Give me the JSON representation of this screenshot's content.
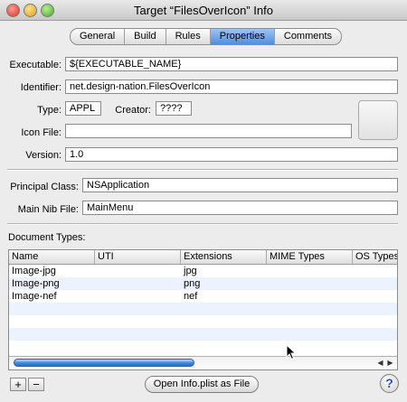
{
  "window": {
    "title": "Target “FilesOverIcon” Info"
  },
  "tabs": [
    {
      "label": "General",
      "active": false
    },
    {
      "label": "Build",
      "active": false
    },
    {
      "label": "Rules",
      "active": false
    },
    {
      "label": "Properties",
      "active": true
    },
    {
      "label": "Comments",
      "active": false
    }
  ],
  "form": {
    "executable_label": "Executable:",
    "executable_value": "${EXECUTABLE_NAME}",
    "identifier_label": "Identifier:",
    "identifier_value": "net.design-nation.FilesOverIcon",
    "type_label": "Type:",
    "type_value": "APPL",
    "creator_label": "Creator:",
    "creator_value": "????",
    "iconfile_label": "Icon File:",
    "iconfile_value": "",
    "version_label": "Version:",
    "version_value": "1.0",
    "principal_label": "Principal Class:",
    "principal_value": "NSApplication",
    "mainnib_label": "Main Nib File:",
    "mainnib_value": "MainMenu"
  },
  "doctypes": {
    "label": "Document Types:",
    "columns": [
      "Name",
      "UTI",
      "Extensions",
      "MIME Types",
      "OS Types"
    ],
    "rows": [
      {
        "name": "Image-jpg",
        "uti": "",
        "extensions": "jpg",
        "mime": "",
        "os": ""
      },
      {
        "name": "Image-png",
        "uti": "",
        "extensions": "png",
        "mime": "",
        "os": ""
      },
      {
        "name": "Image-nef",
        "uti": "",
        "extensions": "nef",
        "mime": "",
        "os": ""
      }
    ]
  },
  "footer": {
    "add_label": "+",
    "remove_label": "−",
    "open_plist_label": "Open Info.plist as File",
    "help_label": "?"
  },
  "colors": {
    "active_tab": "#5b96e4",
    "row_alt": "#edf3fe"
  }
}
